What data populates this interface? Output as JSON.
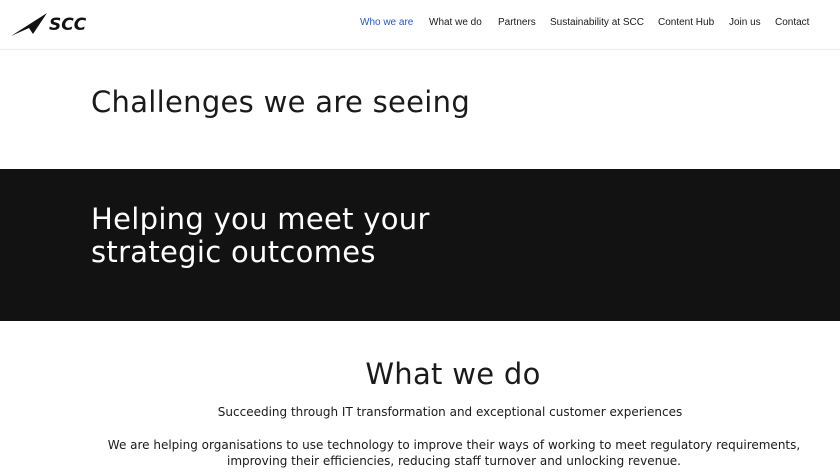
{
  "brand": {
    "name": "SCC",
    "logo_icon": "scc-swoosh-icon",
    "accent_color": "#2a56c6",
    "dark_band_color": "#121212"
  },
  "nav": {
    "items": [
      {
        "label": "Who we are",
        "active": true
      },
      {
        "label": "What we do",
        "active": false
      },
      {
        "label": "Partners",
        "active": false
      },
      {
        "label": "Sustainability at SCC",
        "active": false
      },
      {
        "label": "Content Hub",
        "active": false
      },
      {
        "label": "Join us",
        "active": false
      },
      {
        "label": "Contact",
        "active": false
      }
    ]
  },
  "challenges": {
    "heading": "Challenges we are seeing"
  },
  "strategic": {
    "heading": "Helping you meet your strategic outcomes"
  },
  "what_we_do": {
    "heading": "What we do",
    "subtitle": "Succeeding through IT transformation and exceptional customer experiences",
    "body": "We are helping organisations to use technology to improve their ways of working to meet regulatory requirements, improving their efficiencies, reducing staff turnover and unlocking revenue."
  }
}
